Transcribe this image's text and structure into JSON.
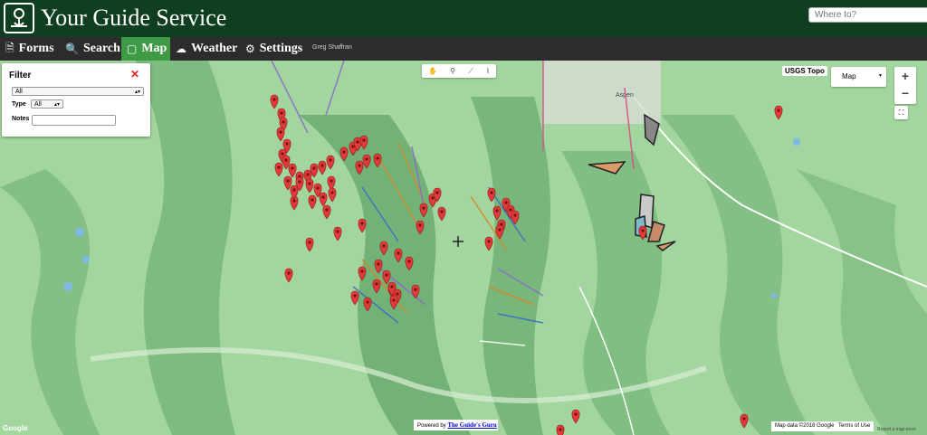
{
  "header": {
    "title": "Your Guide Service",
    "search_placeholder": "Where to?"
  },
  "nav": {
    "items": [
      {
        "label": "Forms",
        "icon": "document-icon"
      },
      {
        "label": "Search",
        "icon": "magnifier-icon"
      },
      {
        "label": "Map",
        "icon": "map-icon",
        "active": true
      },
      {
        "label": "Weather",
        "icon": "cloud-sun-icon"
      },
      {
        "label": "Settings",
        "icon": "gear-icon"
      }
    ],
    "user": "Greg Shaffran"
  },
  "filter": {
    "title": "Filter",
    "main_select": "All",
    "type_label": "Type",
    "type_value": "All",
    "notes_label": "Notes",
    "notes_value": ""
  },
  "map": {
    "layer_label": "USGS Topo",
    "map_type": "Map",
    "town_label": "Aspen",
    "powered_by_prefix": "Powered by",
    "powered_by_link": "The Guide's Guru",
    "map_data": "Map data ©2018 Google",
    "terms": "Terms of Use",
    "report": "Report a map error",
    "google": "Google"
  },
  "colors": {
    "header_bg": "#0f3f20",
    "nav_bg": "#2c2c2c",
    "nav_active": "#3f9a45",
    "marker": "#e03a3a",
    "terrain": "#9fd19a"
  }
}
